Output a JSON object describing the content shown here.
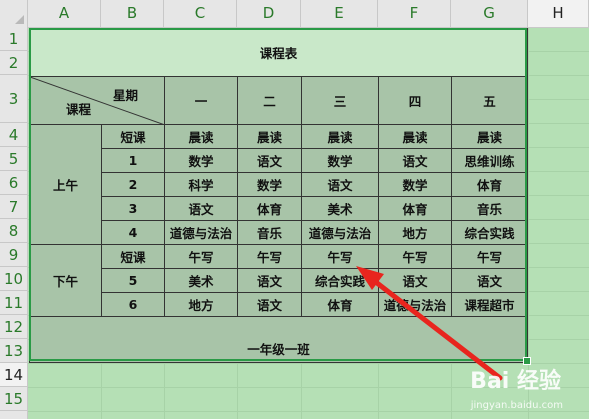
{
  "columns": [
    "A",
    "B",
    "C",
    "D",
    "E",
    "F",
    "G",
    "H"
  ],
  "rows": [
    "1",
    "2",
    "3",
    "4",
    "5",
    "6",
    "7",
    "8",
    "9",
    "10",
    "11",
    "12",
    "13",
    "14",
    "15"
  ],
  "table": {
    "title": "课程表",
    "diag_top": "星期",
    "diag_bottom": "课程",
    "days": [
      "一",
      "二",
      "三",
      "四",
      "五"
    ],
    "morning_label": "上午",
    "afternoon_label": "下午",
    "periods": [
      "短课",
      "1",
      "2",
      "3",
      "4",
      "短课",
      "5",
      "6"
    ],
    "schedule": [
      [
        "晨读",
        "晨读",
        "晨读",
        "晨读",
        "晨读"
      ],
      [
        "数学",
        "语文",
        "数学",
        "语文",
        "思维训练"
      ],
      [
        "科学",
        "数学",
        "语文",
        "数学",
        "体育"
      ],
      [
        "语文",
        "体育",
        "美术",
        "体育",
        "音乐"
      ],
      [
        "道德与法治",
        "音乐",
        "道德与法治",
        "地方",
        "综合实践"
      ],
      [
        "午写",
        "午写",
        "午写",
        "午写",
        "午写"
      ],
      [
        "美术",
        "语文",
        "综合实践",
        "语文",
        "语文"
      ],
      [
        "地方",
        "语文",
        "体育",
        "道德与法治",
        "课程超市"
      ]
    ],
    "footer": "一年级一班"
  },
  "watermark": {
    "text": "Bai 经验",
    "sub": "jingyan.baidu.com"
  },
  "colors": {
    "selection": "#2a9a46",
    "arrow": "#e8251e",
    "cell_bg": "#a8c4a8",
    "title_bg": "#c9e8c9"
  }
}
